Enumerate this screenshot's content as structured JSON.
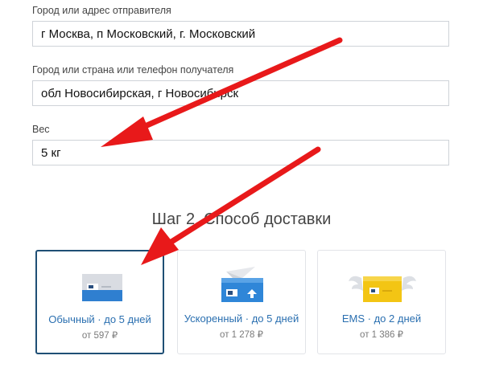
{
  "form": {
    "sender_label": "Город или адрес отправителя",
    "sender_value": "г Москва, п Московский, г. Московский",
    "recipient_label": "Город или страна или телефон получателя",
    "recipient_value": "обл Новосибирская, г Новосибирск",
    "weight_label": "Вес",
    "weight_value": "5 кг"
  },
  "step2": {
    "title": "Шаг 2. Способ доставки",
    "options": [
      {
        "title": "Обычный · до 5 дней",
        "price": "от 597 ₽",
        "selected": true,
        "icon": "parcel-icon"
      },
      {
        "title": "Ускоренный · до 5 дней",
        "price": "от 1 278 ₽",
        "selected": false,
        "icon": "express-parcel-icon"
      },
      {
        "title": "EMS · до 2 дней",
        "price": "от 1 386 ₽",
        "selected": false,
        "icon": "winged-box-icon"
      }
    ]
  },
  "colors": {
    "arrow": "#e8191a",
    "accent_text": "#2a6fb0",
    "selected_border": "#1f4f75"
  }
}
